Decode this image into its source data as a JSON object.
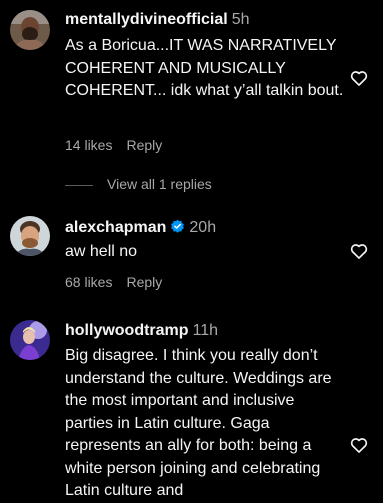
{
  "comments": [
    {
      "username": "mentallydivineofficial",
      "time": "5h",
      "verified": false,
      "text": "As a Boricua...IT WAS NARRATIVELY COHERENT AND MUSICALLY COHERENT... idk what y’all talkin bout.",
      "likes": "14 likes",
      "reply_label": "Reply",
      "avatar_icon": "avatar-photo-bearded-man",
      "like_icon": "heart-outline-icon"
    },
    {
      "username": "alexchapman",
      "time": "20h",
      "verified": true,
      "text": "aw hell no",
      "likes": "68 likes",
      "reply_label": "Reply",
      "avatar_icon": "avatar-photo-man-with-beard",
      "like_icon": "heart-outline-icon"
    },
    {
      "username": "hollywoodtramp",
      "time": "11h",
      "verified": false,
      "text": "Big disagree. I think you really don’t understand the culture. Weddings are the most important and inclusive parties in Latin culture. Gaga represents an ally for both: being a white person joining and celebrating Latin culture and",
      "avatar_icon": "avatar-photo-performer-purple",
      "like_icon": "heart-outline-icon"
    }
  ],
  "view_replies": "View all 1 replies",
  "colors": {
    "background": "#000000",
    "primary_text": "#f5f5f5",
    "secondary_text": "#a8a8a8",
    "verified_badge": "#0095f6"
  }
}
